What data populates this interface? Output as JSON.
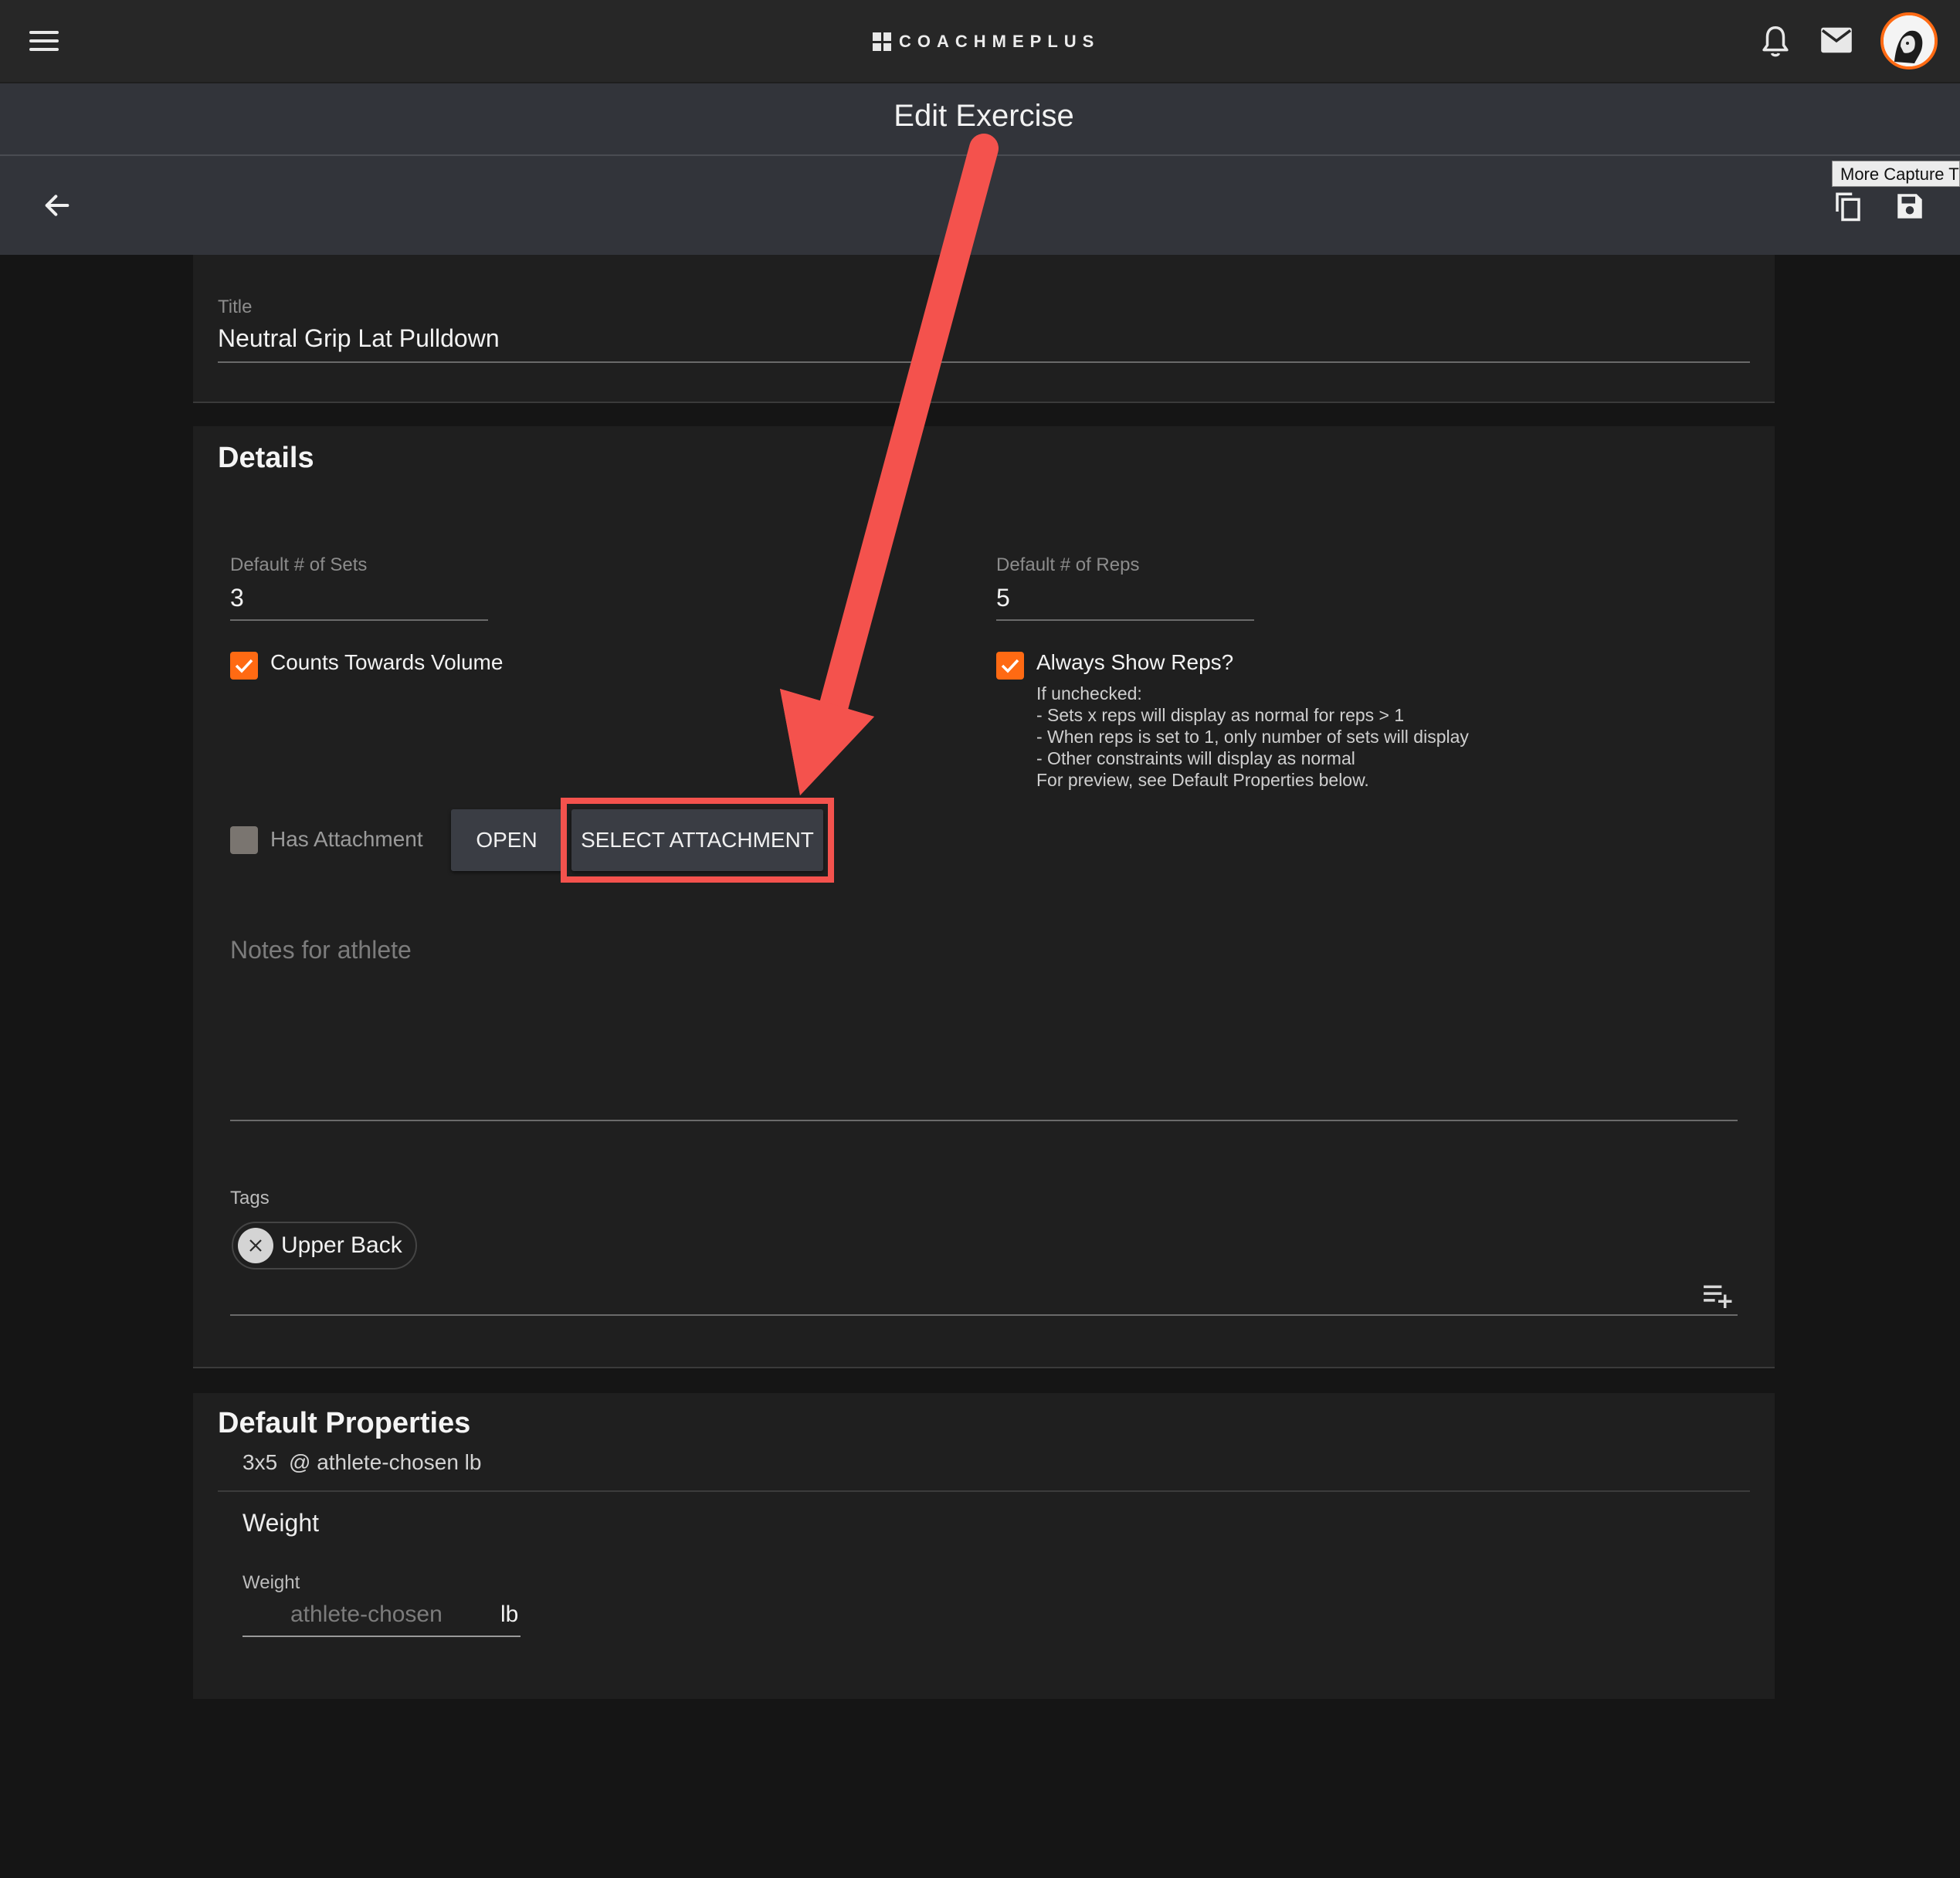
{
  "app": {
    "brand": "COACHMEPLUS",
    "page_title": "Edit Exercise",
    "tooltip": "More Capture T"
  },
  "icons": {
    "menu": "menu-icon",
    "notifications": "bell-icon",
    "messages": "mail-icon",
    "back": "arrow-left-icon",
    "duplicate": "copy-icon",
    "save": "save-icon",
    "tag_remove": "close-icon",
    "add_tag": "playlist-add-icon"
  },
  "colors": {
    "accent": "#ff6a13",
    "annotation": "#f4524d"
  },
  "title_field": {
    "label": "Title",
    "value": "Neutral Grip Lat Pulldown"
  },
  "details": {
    "heading": "Details",
    "sets": {
      "label": "Default # of Sets",
      "value": "3"
    },
    "reps": {
      "label": "Default # of Reps",
      "value": "5"
    },
    "counts_towards_volume": {
      "label": "Counts Towards Volume",
      "checked": true
    },
    "always_show_reps": {
      "label": "Always Show Reps?",
      "checked": true,
      "help": [
        "If unchecked:",
        "- Sets x reps will display as normal for reps > 1",
        "- When reps is set to 1, only number of sets will display",
        "- Other constraints will display as normal",
        "For preview, see Default Properties below."
      ]
    },
    "has_attachment": {
      "label": "Has Attachment",
      "checked": false
    },
    "open_button": "OPEN",
    "select_attachment_button": "SELECT ATTACHMENT",
    "notes_placeholder": "Notes for athlete",
    "tags": {
      "label": "Tags",
      "items": [
        "Upper Back"
      ]
    }
  },
  "default_properties": {
    "heading": "Default Properties",
    "summary_sets_reps": "3x5",
    "summary_weight": "@ athlete-chosen lb",
    "weight_section_title": "Weight",
    "weight_field": {
      "label": "Weight",
      "placeholder": "athlete-chosen",
      "unit": "lb"
    }
  }
}
